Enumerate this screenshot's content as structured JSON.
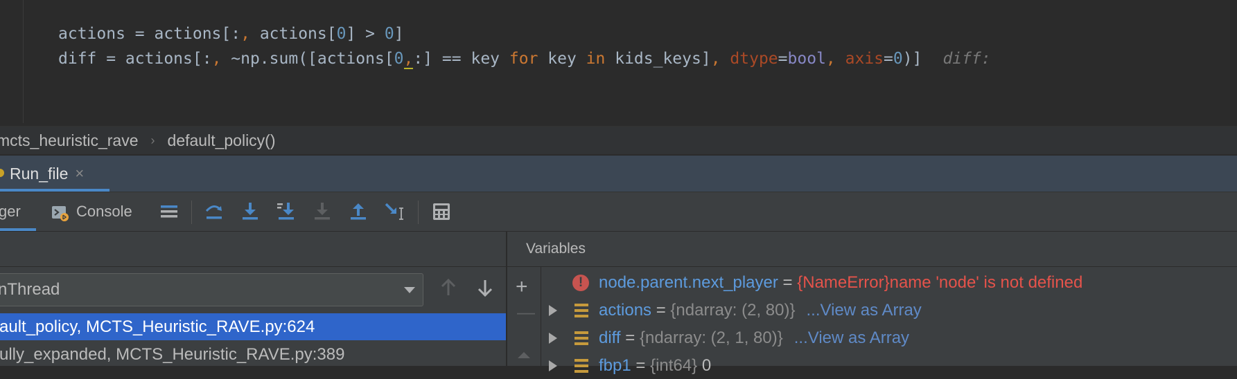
{
  "editor": {
    "line1": {
      "lhs": "actions = actions[:",
      "comma": ",",
      "mid": " actions[",
      "idx0": "0",
      "mid2": "] > ",
      "zero": "0",
      "end": "]"
    },
    "line2": {
      "lhs": "diff = actions[:",
      "comma": ",",
      "mid": " ~np.sum([actions[",
      "idx0": "0",
      "caret": ",",
      "mid2": ":] == key ",
      "kw_for": "for",
      "mid3": " key ",
      "kw_in": "in",
      "mid4": " kids_keys]",
      "comma2": ",",
      "space1": " ",
      "p_dtype": "dtype",
      "eq1": "=",
      "bool": "bool",
      "comma3": ",",
      "space2": " ",
      "p_axis": "axis",
      "eq2": "=",
      "zero": "0",
      "end": ")]",
      "inlay": "diff:"
    }
  },
  "breadcrumb": {
    "file": "mcts_heuristic_rave",
    "function": "default_policy()"
  },
  "run_tab": {
    "label": "Run_file",
    "close": "×"
  },
  "toolbar": {
    "debugger_tab": "ger",
    "console_tab": "Console",
    "buttons": [
      "show-execution-point",
      "step-over",
      "step-into",
      "step-into-my-code",
      "force-step-into",
      "step-out",
      "run-to-cursor",
      "evaluate-expression"
    ]
  },
  "frames": {
    "thread": "nThread",
    "items": [
      "ault_policy, MCTS_Heuristic_RAVE.py:624",
      "ully_expanded, MCTS_Heuristic_RAVE.py:389"
    ]
  },
  "variables": {
    "title": "Variables",
    "rows": [
      {
        "name": "node.parent.next_player",
        "eq": " = ",
        "type": "{NameError}",
        "value": "name 'node' is not defined",
        "link": ""
      },
      {
        "name": "actions",
        "eq": " = ",
        "type": "{ndarray: (2, 80)}",
        "value": "",
        "link": "...View as Array"
      },
      {
        "name": "diff",
        "eq": " = ",
        "type": "{ndarray: (2, 1, 80)}",
        "value": "",
        "link": "...View as Array"
      },
      {
        "name": "fbp1",
        "eq": " = ",
        "type": "{int64} ",
        "value": "0",
        "link": ""
      }
    ]
  },
  "colors": {
    "editor_bg": "#2b2b2b",
    "panel_bg": "#3c3f41",
    "selection": "#2f65ca",
    "accent": "#4a88c7",
    "var_name": "#5d9bde",
    "error": "#e5534b"
  }
}
